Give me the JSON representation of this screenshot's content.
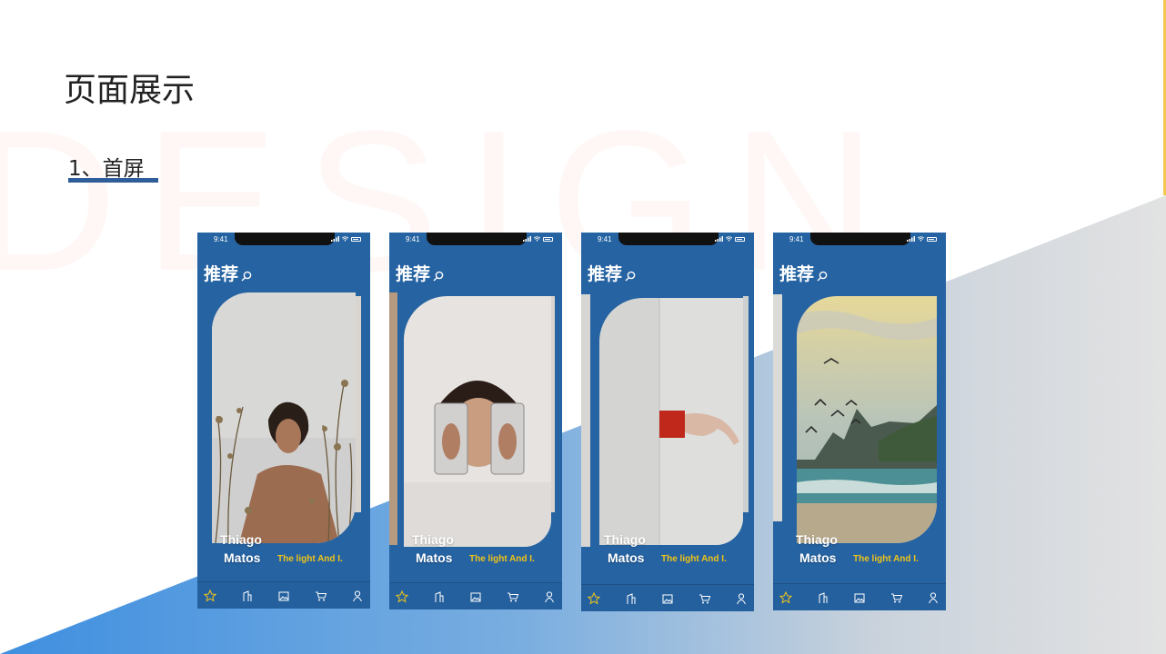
{
  "page": {
    "title": "页面展示",
    "section_label": "1、首屏",
    "watermark": "DESIGN"
  },
  "colors": {
    "phone_bg": "#2663a2",
    "accent_yellow": "#f0c419",
    "section_underline": "#2f5d9a",
    "wedge_left": "#3f8fe0",
    "wedge_right": "#e4e4e4"
  },
  "phones": [
    {
      "status_time": "9:41",
      "header_title": "推荐",
      "artist_line1": "Thiago",
      "artist_line2": "Matos",
      "track_title": "The light And I.",
      "scene": "portrait-plants"
    },
    {
      "status_time": "9:41",
      "header_title": "推荐",
      "artist_line1": "Thiago",
      "artist_line2": "Matos",
      "track_title": "The light And I.",
      "scene": "face-glasses"
    },
    {
      "status_time": "9:41",
      "header_title": "推荐",
      "artist_line1": "Thiago",
      "artist_line2": "Matos",
      "track_title": "The light And I.",
      "scene": "hand-wall"
    },
    {
      "status_time": "9:41",
      "header_title": "推荐",
      "artist_line1": "Thiago",
      "artist_line2": "Matos",
      "track_title": "The light And I.",
      "scene": "seascape-birds"
    }
  ],
  "tab_bar": {
    "icons": [
      "star-icon",
      "building-icon",
      "gallery-icon",
      "cart-icon",
      "user-icon"
    ],
    "active": "star-icon"
  }
}
